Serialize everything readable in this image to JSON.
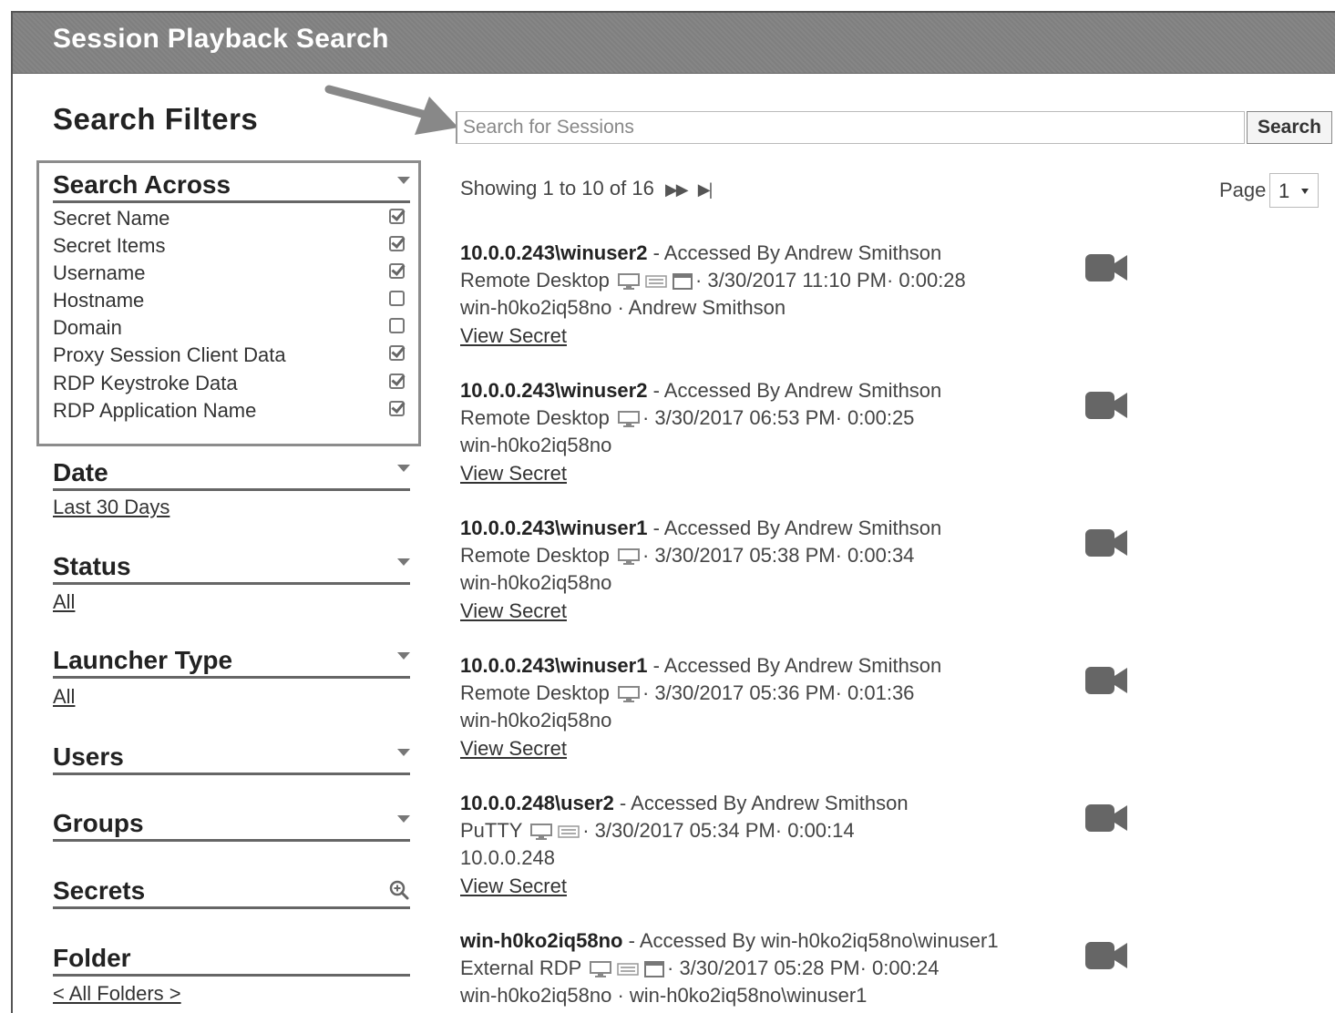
{
  "header": {
    "title": "Session Playback Search"
  },
  "search": {
    "placeholder": "Search for Sessions",
    "button_label": "Search"
  },
  "filters": {
    "title": "Search Filters",
    "search_across": {
      "label": "Search Across",
      "options": [
        {
          "label": "Secret Name",
          "checked": true
        },
        {
          "label": "Secret Items",
          "checked": true
        },
        {
          "label": "Username",
          "checked": true
        },
        {
          "label": "Hostname",
          "checked": false
        },
        {
          "label": "Domain",
          "checked": false
        },
        {
          "label": "Proxy Session Client Data",
          "checked": true
        },
        {
          "label": "RDP Keystroke Data",
          "checked": true
        },
        {
          "label": "RDP Application Name",
          "checked": true
        }
      ]
    },
    "date": {
      "label": "Date",
      "value": "Last 30 Days"
    },
    "status": {
      "label": "Status",
      "value": "All"
    },
    "launcher_type": {
      "label": "Launcher Type",
      "value": "All"
    },
    "users": {
      "label": "Users"
    },
    "groups": {
      "label": "Groups"
    },
    "secrets": {
      "label": "Secrets"
    },
    "folder": {
      "label": "Folder",
      "value": "< All Folders >"
    }
  },
  "results": {
    "showing": "Showing 1 to 10 of 16",
    "page_label": "Page",
    "page_value": "1",
    "items": [
      {
        "title": "10.0.0.243\\winuser2",
        "accessed": " - Accessed By Andrew Smithson",
        "launcher": "Remote Desktop",
        "icons": [
          "monitor-icon",
          "keyboard-icon",
          "window-icon"
        ],
        "meta": "· 3/30/2017 11:10 PM· 0:00:28",
        "host": "win-h0ko2iq58no · Andrew Smithson",
        "link": "View Secret"
      },
      {
        "title": "10.0.0.243\\winuser2",
        "accessed": " - Accessed By Andrew Smithson",
        "launcher": "Remote Desktop",
        "icons": [
          "monitor-icon"
        ],
        "meta": "· 3/30/2017 06:53 PM· 0:00:25",
        "host": "win-h0ko2iq58no",
        "link": "View Secret"
      },
      {
        "title": "10.0.0.243\\winuser1",
        "accessed": " - Accessed By Andrew Smithson",
        "launcher": "Remote Desktop",
        "icons": [
          "monitor-icon"
        ],
        "meta": "· 3/30/2017 05:38 PM· 0:00:34",
        "host": "win-h0ko2iq58no",
        "link": "View Secret"
      },
      {
        "title": "10.0.0.243\\winuser1",
        "accessed": " - Accessed By Andrew Smithson",
        "launcher": "Remote Desktop",
        "icons": [
          "monitor-icon"
        ],
        "meta": "· 3/30/2017 05:36 PM· 0:01:36",
        "host": "win-h0ko2iq58no",
        "link": "View Secret"
      },
      {
        "title": "10.0.0.248\\user2",
        "accessed": " - Accessed By Andrew Smithson",
        "launcher": "PuTTY",
        "icons": [
          "monitor-icon",
          "keyboard-icon"
        ],
        "meta": "· 3/30/2017 05:34 PM· 0:00:14",
        "host": "10.0.0.248",
        "link": "View Secret"
      },
      {
        "title": "win-h0ko2iq58no",
        "accessed": " - Accessed By win-h0ko2iq58no\\winuser1",
        "launcher": "External RDP",
        "icons": [
          "monitor-icon",
          "keyboard-icon",
          "window-icon"
        ],
        "meta": "· 3/30/2017 05:28 PM· 0:00:24",
        "host": "win-h0ko2iq58no · win-h0ko2iq58no\\winuser1",
        "link": ""
      }
    ]
  },
  "colors": {
    "header_bg": "#7f7f7f",
    "text": "#333333",
    "icon_gray": "#666666"
  }
}
